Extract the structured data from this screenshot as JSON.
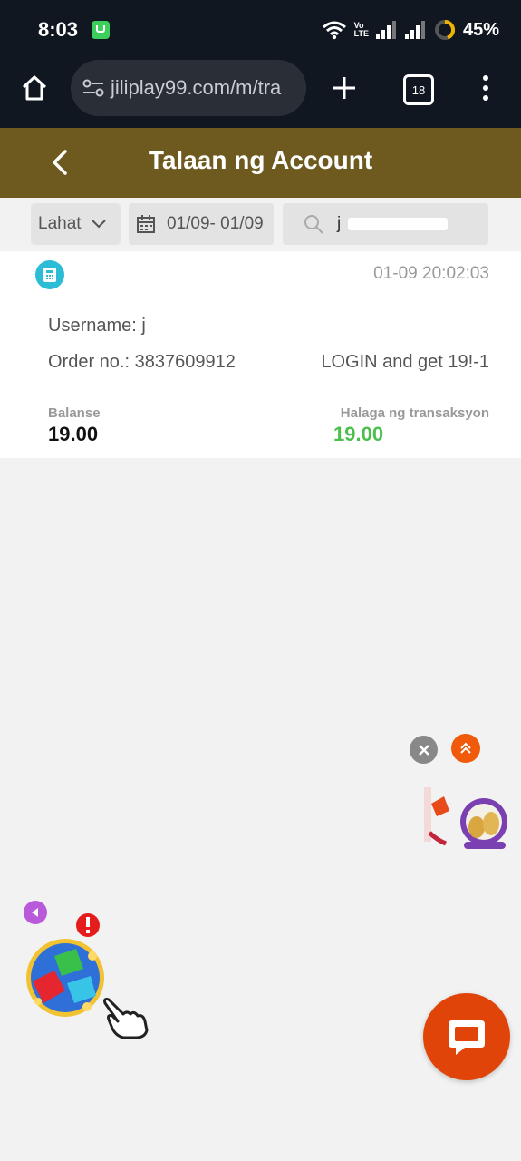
{
  "status_bar": {
    "time": "8:03",
    "network_label_top": "Vo",
    "network_label_bottom": "LTE",
    "battery_percent": "45%"
  },
  "browser": {
    "url": "jiliplay99.com/m/tra",
    "tab_count": "18"
  },
  "header": {
    "title": "Talaan ng Account",
    "color": "#6e5a1f"
  },
  "filters": {
    "type_selected": "Lahat",
    "date_range": "01/09- 01/09",
    "search_value": "j"
  },
  "record": {
    "timestamp": "01-09 20:02:03",
    "username_label": "Username: j",
    "order_line": "Order no.: 3837609912",
    "description": "LOGIN and get 19!-1",
    "balance_label": "Balanse",
    "balance_value": "19.00",
    "amount_label": "Halaga ng transaksyon",
    "amount_value": "19.00",
    "amount_color": "#4cbf4c"
  }
}
